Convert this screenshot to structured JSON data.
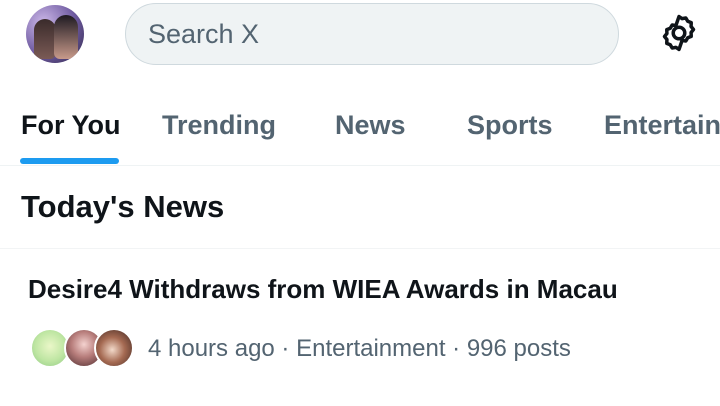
{
  "header": {
    "search": {
      "placeholder": "Search X",
      "icon": "search-field"
    },
    "settings_icon": "gear-icon"
  },
  "tabs": [
    {
      "label": "For You",
      "active": true
    },
    {
      "label": "Trending",
      "active": false
    },
    {
      "label": "News",
      "active": false
    },
    {
      "label": "Sports",
      "active": false
    },
    {
      "label": "Entertain",
      "active": false
    }
  ],
  "section": {
    "title": "Today's News"
  },
  "news": [
    {
      "headline": "Desire4 Withdraws from WIEA Awards in Macau",
      "meta": "4 hours ago · Entertainment · 996 posts"
    }
  ],
  "colors": {
    "accent": "#1d9bf0",
    "text_primary": "#0f1419",
    "text_secondary": "#536471",
    "search_bg": "#eff3f4"
  }
}
